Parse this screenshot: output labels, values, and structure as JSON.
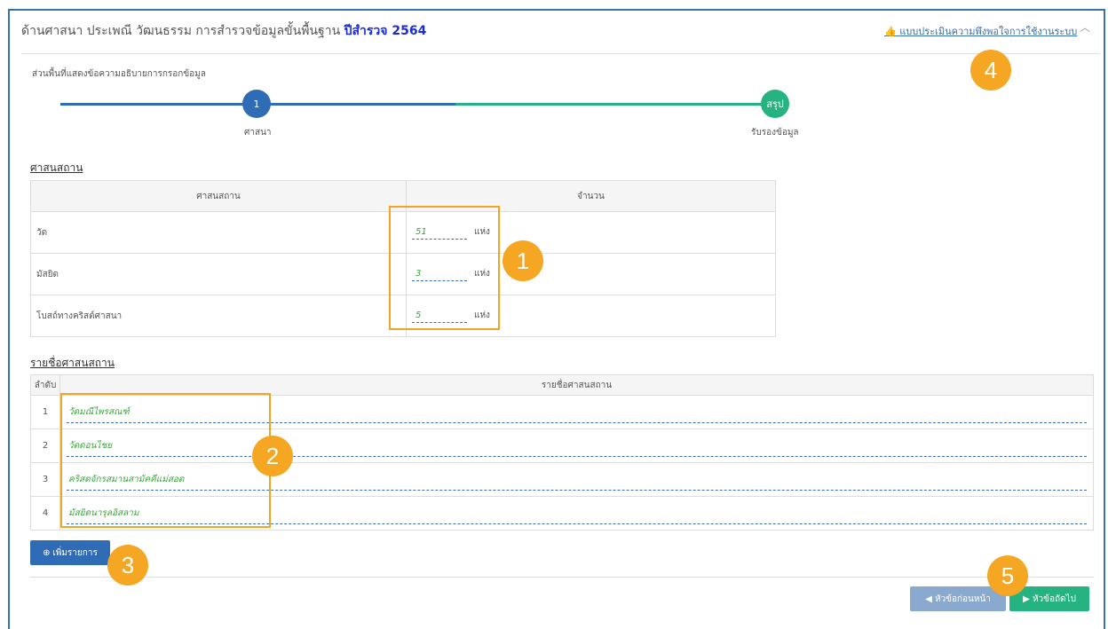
{
  "header": {
    "title": "ด้านศาสนา ประเพณี วัฒนธรรม การสำรวจข้อมูลขั้นพื้นฐาน",
    "year_label": "ปีสำรวจ 2564",
    "survey_link": "แบบประเมินความพึงพอใจการใช้งานระบบ"
  },
  "help_text": "ส่วนพื้นที่แสดงข้อความอธิบายการกรอกข้อมูล",
  "steps": [
    {
      "badge": "1",
      "label": "ศาสนา"
    },
    {
      "badge": "สรุป",
      "label": "รับรองข้อมูล"
    }
  ],
  "section1": {
    "title": "ศาสนสถาน",
    "col1": "ศาสนสถาน",
    "col2": "จำนวน",
    "rows": [
      {
        "name": "วัด",
        "value": "51",
        "unit": "แห่ง"
      },
      {
        "name": "มัสยิด",
        "value": "3",
        "unit": "แห่ง"
      },
      {
        "name": "โบสถ์ทางคริสต์ศาสนา",
        "value": "5",
        "unit": "แห่ง"
      }
    ]
  },
  "section2": {
    "title": "รายชื่อศาสนสถาน",
    "col1": "ลำดับ",
    "col2": "รายชื่อศาสนสถาน",
    "rows": [
      {
        "idx": "1",
        "name": "วัดมณีไพรสณฑ์"
      },
      {
        "idx": "2",
        "name": "วัดดอนไชย"
      },
      {
        "idx": "3",
        "name": "คริสตจักรสมานสามัคคีแม่สอด"
      },
      {
        "idx": "4",
        "name": "มัสยิดนารุลอิสลาม"
      }
    ]
  },
  "buttons": {
    "add": "เพิ่มรายการ",
    "prev": "หัวข้อก่อนหน้า",
    "next": "หัวข้อถัดไป"
  },
  "annotations": [
    "1",
    "2",
    "3",
    "4",
    "5"
  ],
  "colors": {
    "accent": "#2f6cb5",
    "success": "#26b382",
    "highlight": "#f5a623"
  }
}
